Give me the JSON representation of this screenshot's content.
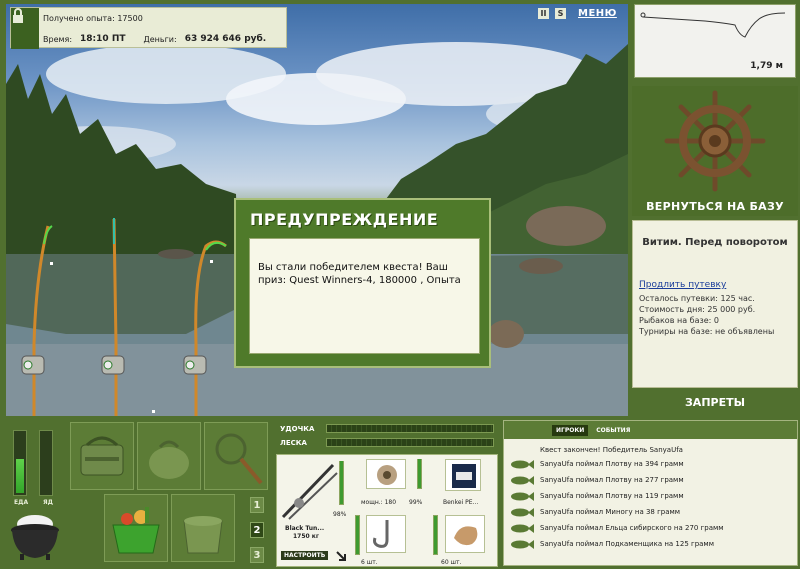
{
  "info": {
    "experience_label": "Получено опыта:",
    "experience_value": "17500",
    "time_label": "Время:",
    "time_value": "18:10 ПТ",
    "money_label": "Деньги:",
    "money_value": "63 924 646 руб."
  },
  "top_icons": {
    "pause": "II",
    "sound": "S",
    "menu": "МЕНЮ"
  },
  "depth": {
    "value": "1,79 м"
  },
  "right": {
    "back_button": "ВЕРНУТЬСЯ НА БАЗУ",
    "place_title": "Витим. Перед поворотом",
    "extend_link": "Продлить путевку",
    "lines": [
      "Осталось путевки: 125 час.",
      "Стоимость дня: 25 000 руб.",
      "Рыбаков на базе: 0",
      "Турниры на базе: не объявлены"
    ],
    "bans": "ЗАПРЕТЫ"
  },
  "dialog": {
    "title": "ПРЕДУПРЕЖДЕНИЕ",
    "text": "Вы стали победителем квеста! Ваш приз: Quest Winners-4, 180000 , Опыта"
  },
  "stats": {
    "food_label": "ЕДА",
    "poison_label": "ЯД",
    "food_level": 0.55,
    "poison_level": 0.0
  },
  "pages": [
    "1",
    "2",
    "3"
  ],
  "gear": {
    "rod_label": "УДОЧКА",
    "line_label": "ЛЕСКА",
    "rod_name": "Black Tun...",
    "rod_weight": "1750 кг",
    "rod_pct": "98%",
    "setup_button": "НАСТРОИТЬ",
    "reel_label": "мощн.: 180",
    "reel_pct": "99%",
    "line_name": "Benkei PE...",
    "hook_count": "6 шт.",
    "bait_count": "60 шт."
  },
  "chat": {
    "tabs": [
      "ИГРОКИ",
      "СОБЫТИЯ"
    ],
    "header_msg": "Квест закончен! Победитель SanyaUfa",
    "messages": [
      "SanyaUfa поймал Плотву на 394 грамм",
      "SanyaUfa поймал Плотву на 277 грамм",
      "SanyaUfa поймал Плотву на 119 грамм",
      "SanyaUfa поймал Миногу на 38 грамм",
      "SanyaUfa поймал Ельца сибирского на 270 грамм",
      "SanyaUfa поймал Подкаменщика на 125 грамм"
    ]
  }
}
